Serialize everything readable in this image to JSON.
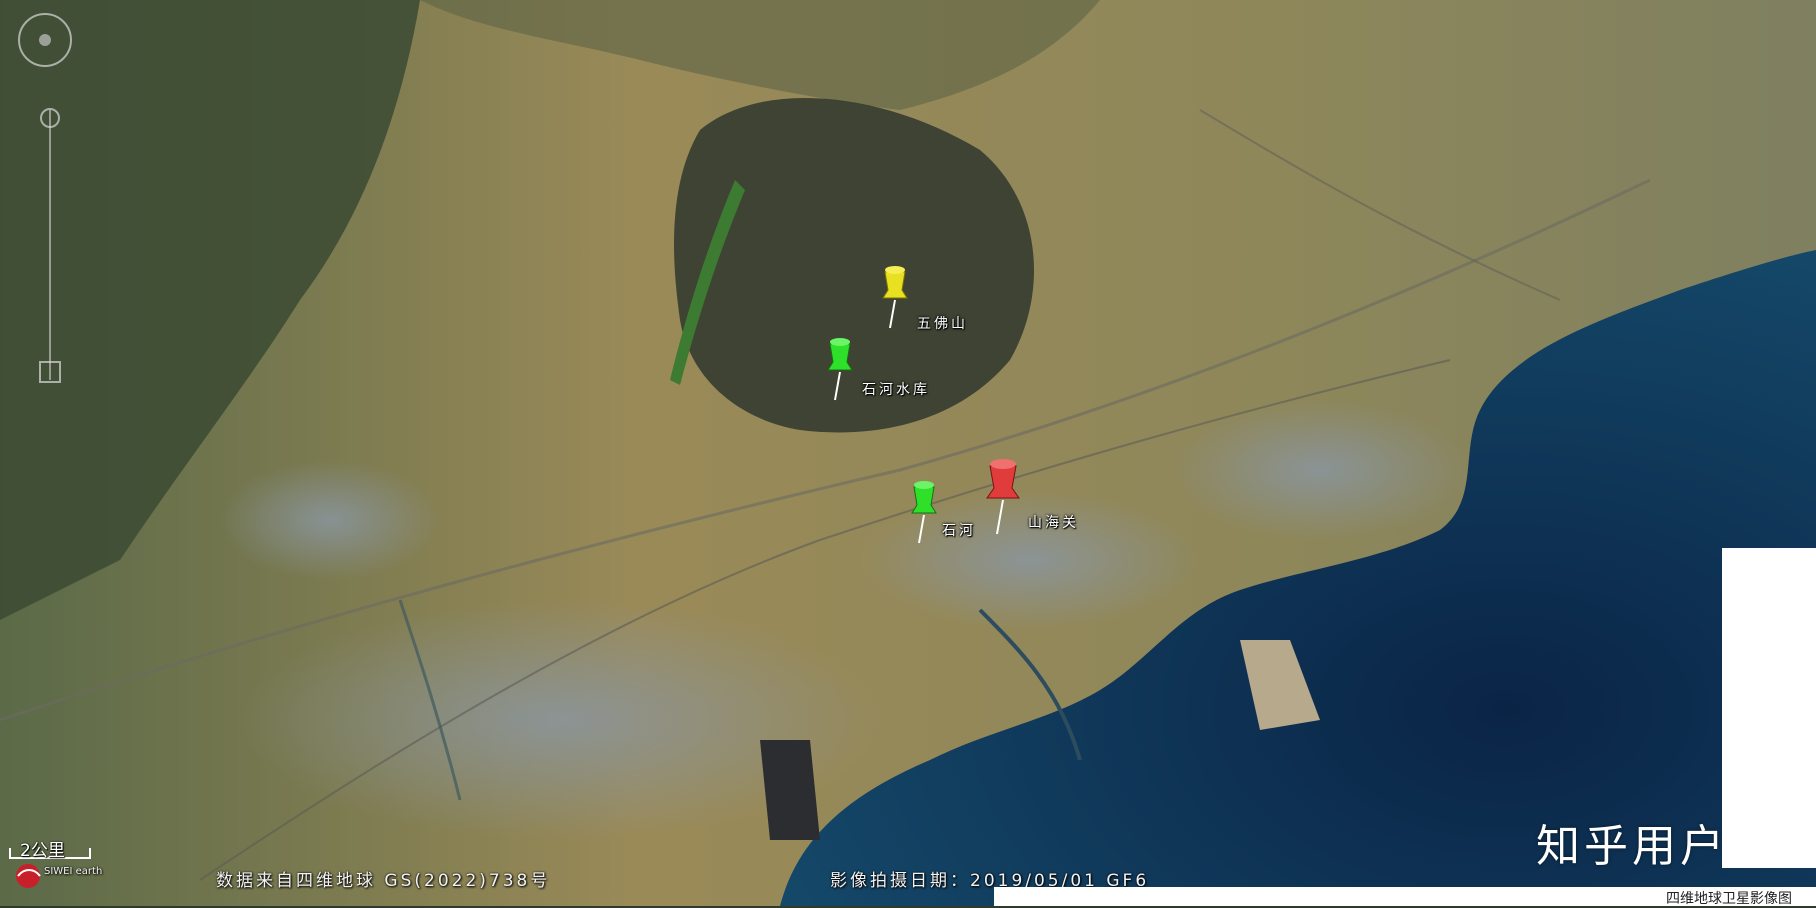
{
  "markers": [
    {
      "label": "五佛山",
      "color": "yellow"
    },
    {
      "label": "石河水库",
      "color": "green"
    },
    {
      "label": "石河",
      "color": "green"
    },
    {
      "label": "山海关",
      "color": "red"
    }
  ],
  "scale": {
    "label": "2公里"
  },
  "logo": {
    "text": "SIWEI earth"
  },
  "footer": {
    "source": "数据来自四维地球 GS(2022)738号",
    "date": "影像拍摄日期：2019/05/01 GF6",
    "caption": "四维地球卫星影像图"
  },
  "watermark": "知乎用户",
  "colors": {
    "sea": "#0b2a4d",
    "land": "#8c8350",
    "mountain": "#3a4232",
    "pin_yellow": "#e8e020",
    "pin_green": "#2ee02a",
    "pin_red": "#e03c3c"
  }
}
